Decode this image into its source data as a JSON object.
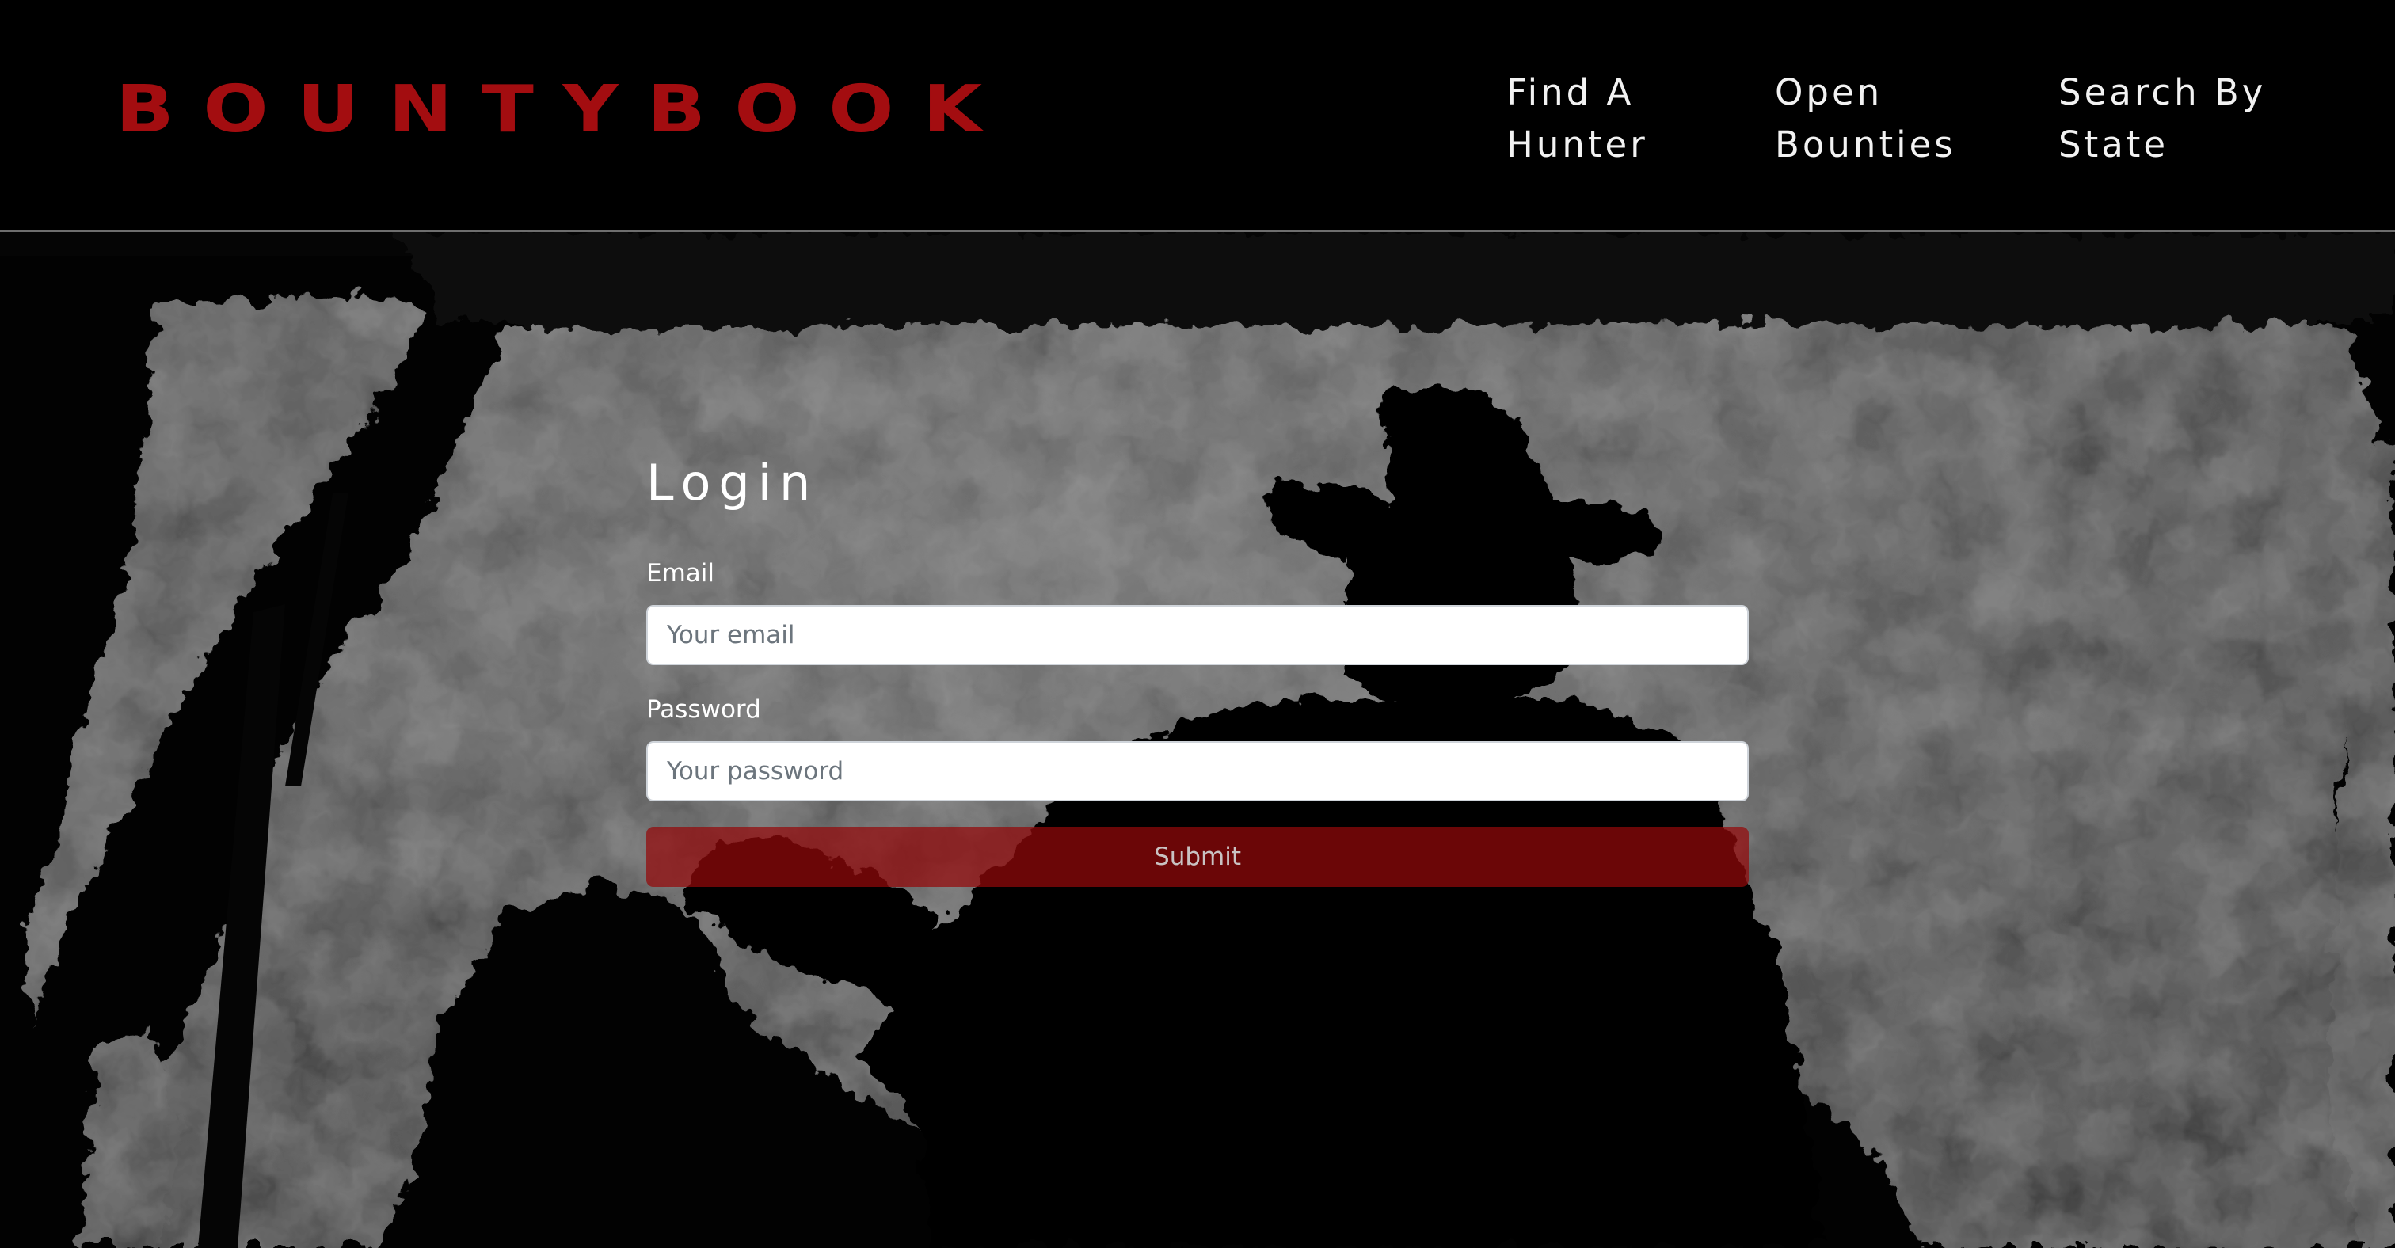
{
  "header": {
    "brand": "BOUNTYBOOK",
    "nav_links": [
      {
        "line1": "Find A",
        "line2": "Hunter"
      },
      {
        "line1": "Open",
        "line2": "Bounties"
      },
      {
        "line1": "Search By",
        "line2": "State"
      }
    ]
  },
  "login": {
    "title": "Login",
    "email_label": "Email",
    "email_placeholder": "Your email",
    "email_value": "",
    "password_label": "Password",
    "password_placeholder": "Your password",
    "password_value": "",
    "submit_label": "Submit"
  },
  "colors": {
    "brand": "#a30d10",
    "background": "#000000",
    "submit_button": "#94080a"
  },
  "icons": {
    "hero_image": "cowboy-silhouette-image"
  }
}
